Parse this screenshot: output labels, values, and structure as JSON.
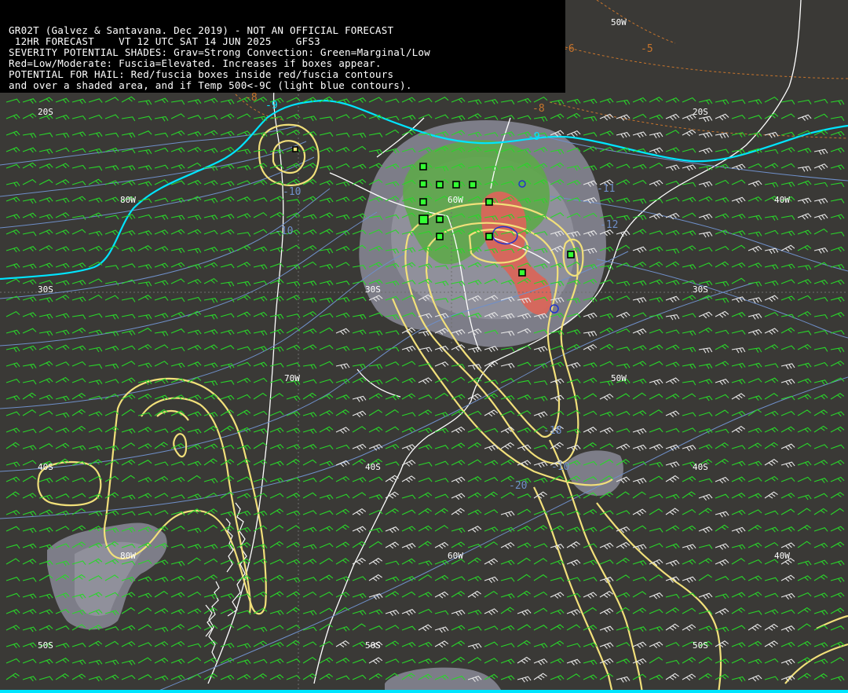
{
  "header": {
    "line1": "GR02T (Galvez & Santavana. Dec 2019) - NOT AN OFFICIAL FORECAST",
    "line2": " 12HR FORECAST    VT 12 UTC SAT 14 JUN 2025    GFS3",
    "line3": "SEVERITY POTENTIAL SHADES: Grav=Strong Convection: Green=Marginal/Low",
    "line4": "Red=Low/Moderate: Fuscia=Elevated. Increases if boxes appear.",
    "line5": "POTENTIAL FOR HAIL: Red/fuscia boxes inside red/fuscia contours",
    "line6": "and over a shaded area, and if Temp 500<-9C (light blue contours)."
  },
  "grid_labels": {
    "lat_20s_west": "20S",
    "lat_20s_east": "20S",
    "lat_30s_west": "30S",
    "lat_30s_mid": "30S",
    "lat_30s_east": "30S",
    "lat_40s_west": "40S",
    "lat_40s_mid": "40S",
    "lat_40s_east": "40S",
    "lat_50s_west": "50S",
    "lat_50s_mid": "50S",
    "lat_50s_east": "50S",
    "lon_50w_top": "50W",
    "lon_80w_north": "80W",
    "lon_60w_north": "60W",
    "lon_40w_north": "40W",
    "lon_70w_mid": "70W",
    "lon_50w_mid": "50W",
    "lon_80w_south": "80W",
    "lon_60w_south": "60W",
    "lon_40w_south": "40W"
  },
  "contour_labels": {
    "t500_a": "-9",
    "t500_b": "-9",
    "t500_c": "-10",
    "t500_d": "-10",
    "t500_e": "-11",
    "t500_f": "-12",
    "t500_g": "-18",
    "t500_h": "-20",
    "t500_i": "-10",
    "temp_a": "-5",
    "temp_b": "-6",
    "temp_c": "-8",
    "temp_d": "-8"
  },
  "colors": {
    "background": "#3a3936",
    "coastline": "#ffffff",
    "wind_green": "#29d62a",
    "wind_white": "#e8e8e8",
    "hail_contour": "#f2e07a",
    "temp500_contour": "#6f8fc9",
    "frontal_line": "#00e5ff",
    "marginal_shade": "#6aa84f",
    "moderate_shade": "#d9685a",
    "strong_shade_gray": "#8c8c99",
    "box_green": "#33ff33",
    "dashed_temp": "#c8752c"
  },
  "map_info": {
    "region": "South America",
    "projection": "cylindrical",
    "lon_range_deg": [
      -90,
      -30
    ],
    "lat_range_deg": [
      -55,
      -15
    ]
  }
}
